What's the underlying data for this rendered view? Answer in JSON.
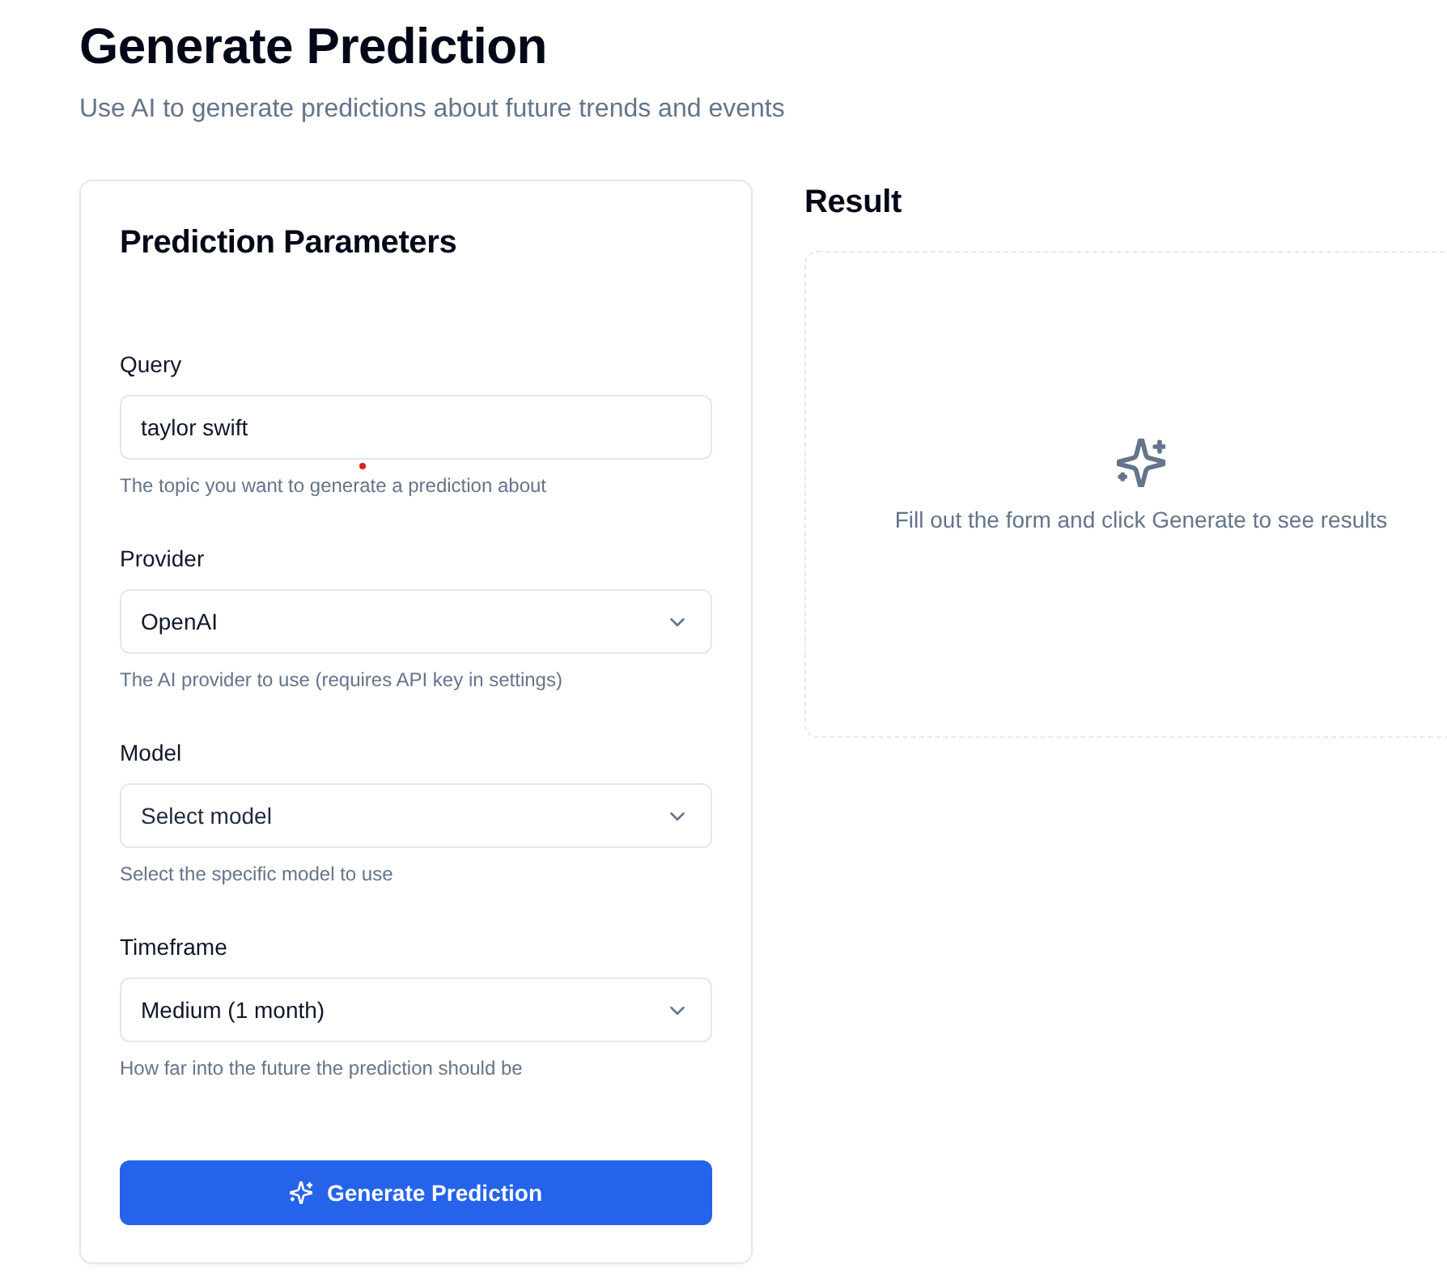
{
  "page": {
    "title": "Generate Prediction",
    "subtitle": "Use AI to generate predictions about future trends and events"
  },
  "form": {
    "title": "Prediction Parameters",
    "fields": [
      {
        "kind": "text",
        "label": "Query",
        "value": "taylor swift",
        "help": "The topic you want to generate a prediction about"
      },
      {
        "kind": "select",
        "label": "Provider",
        "value": "OpenAI",
        "help": "The AI provider to use (requires API key in settings)"
      },
      {
        "kind": "select",
        "label": "Model",
        "placeholder": "Select model",
        "help": "Select the specific model to use"
      },
      {
        "kind": "select",
        "label": "Timeframe",
        "value": "Medium (1 month)",
        "help": "How far into the future the prediction should be"
      }
    ],
    "submit": {
      "label": "Generate Prediction"
    }
  },
  "result": {
    "title": "Result",
    "empty_message": "Fill out the form and click Generate to see results"
  }
}
